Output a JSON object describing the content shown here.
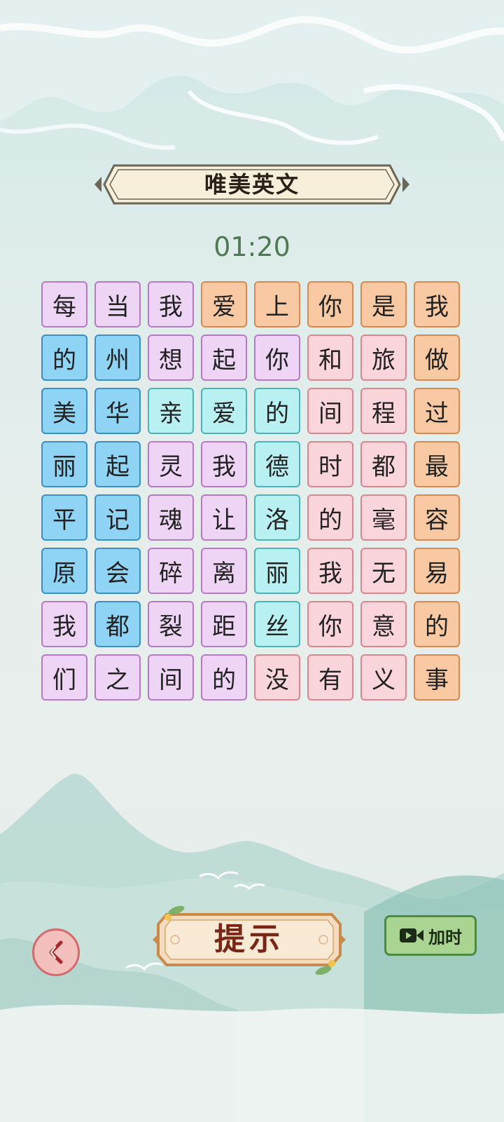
{
  "title": "唯美英文",
  "timer": "01:20",
  "grid": {
    "rows": [
      [
        {
          "ch": "每",
          "color": "purple"
        },
        {
          "ch": "当",
          "color": "purple"
        },
        {
          "ch": "我",
          "color": "purple"
        },
        {
          "ch": "爱",
          "color": "orange"
        },
        {
          "ch": "上",
          "color": "orange"
        },
        {
          "ch": "你",
          "color": "orange"
        },
        {
          "ch": "是",
          "color": "orange"
        },
        {
          "ch": "我",
          "color": "orange"
        }
      ],
      [
        {
          "ch": "的",
          "color": "blue"
        },
        {
          "ch": "州",
          "color": "blue"
        },
        {
          "ch": "想",
          "color": "purple"
        },
        {
          "ch": "起",
          "color": "purple"
        },
        {
          "ch": "你",
          "color": "purple"
        },
        {
          "ch": "和",
          "color": "pink"
        },
        {
          "ch": "旅",
          "color": "pink"
        },
        {
          "ch": "做",
          "color": "orange"
        }
      ],
      [
        {
          "ch": "美",
          "color": "blue"
        },
        {
          "ch": "华",
          "color": "blue"
        },
        {
          "ch": "亲",
          "color": "cyan"
        },
        {
          "ch": "爱",
          "color": "cyan"
        },
        {
          "ch": "的",
          "color": "cyan"
        },
        {
          "ch": "间",
          "color": "pink"
        },
        {
          "ch": "程",
          "color": "pink"
        },
        {
          "ch": "过",
          "color": "orange"
        }
      ],
      [
        {
          "ch": "丽",
          "color": "blue"
        },
        {
          "ch": "起",
          "color": "blue"
        },
        {
          "ch": "灵",
          "color": "purple"
        },
        {
          "ch": "我",
          "color": "purple"
        },
        {
          "ch": "德",
          "color": "cyan"
        },
        {
          "ch": "时",
          "color": "pink"
        },
        {
          "ch": "都",
          "color": "pink"
        },
        {
          "ch": "最",
          "color": "orange"
        }
      ],
      [
        {
          "ch": "平",
          "color": "blue"
        },
        {
          "ch": "记",
          "color": "blue"
        },
        {
          "ch": "魂",
          "color": "purple"
        },
        {
          "ch": "让",
          "color": "purple"
        },
        {
          "ch": "洛",
          "color": "cyan"
        },
        {
          "ch": "的",
          "color": "pink"
        },
        {
          "ch": "毫",
          "color": "pink"
        },
        {
          "ch": "容",
          "color": "orange"
        }
      ],
      [
        {
          "ch": "原",
          "color": "blue"
        },
        {
          "ch": "会",
          "color": "blue"
        },
        {
          "ch": "碎",
          "color": "purple"
        },
        {
          "ch": "离",
          "color": "purple"
        },
        {
          "ch": "丽",
          "color": "cyan"
        },
        {
          "ch": "我",
          "color": "pink"
        },
        {
          "ch": "无",
          "color": "pink"
        },
        {
          "ch": "易",
          "color": "orange"
        }
      ],
      [
        {
          "ch": "我",
          "color": "purple"
        },
        {
          "ch": "都",
          "color": "blue"
        },
        {
          "ch": "裂",
          "color": "purple"
        },
        {
          "ch": "距",
          "color": "purple"
        },
        {
          "ch": "丝",
          "color": "cyan"
        },
        {
          "ch": "你",
          "color": "pink"
        },
        {
          "ch": "意",
          "color": "pink"
        },
        {
          "ch": "的",
          "color": "orange"
        }
      ],
      [
        {
          "ch": "们",
          "color": "purple"
        },
        {
          "ch": "之",
          "color": "purple"
        },
        {
          "ch": "间",
          "color": "purple"
        },
        {
          "ch": "的",
          "color": "purple"
        },
        {
          "ch": "没",
          "color": "pink"
        },
        {
          "ch": "有",
          "color": "pink"
        },
        {
          "ch": "义",
          "color": "pink"
        },
        {
          "ch": "事",
          "color": "orange"
        }
      ]
    ]
  },
  "buttons": {
    "back_icon": "back-arrow-icon",
    "hint_label": "提示",
    "add_time_icon": "video-camera-icon",
    "add_time_label": "加时"
  },
  "colors": {
    "purple": "#eed5f5",
    "orange": "#f8c9a2",
    "blue": "#8fd3f5",
    "pink": "#fbd5dc",
    "cyan": "#b9f1f2",
    "timer": "#4f7a55"
  }
}
